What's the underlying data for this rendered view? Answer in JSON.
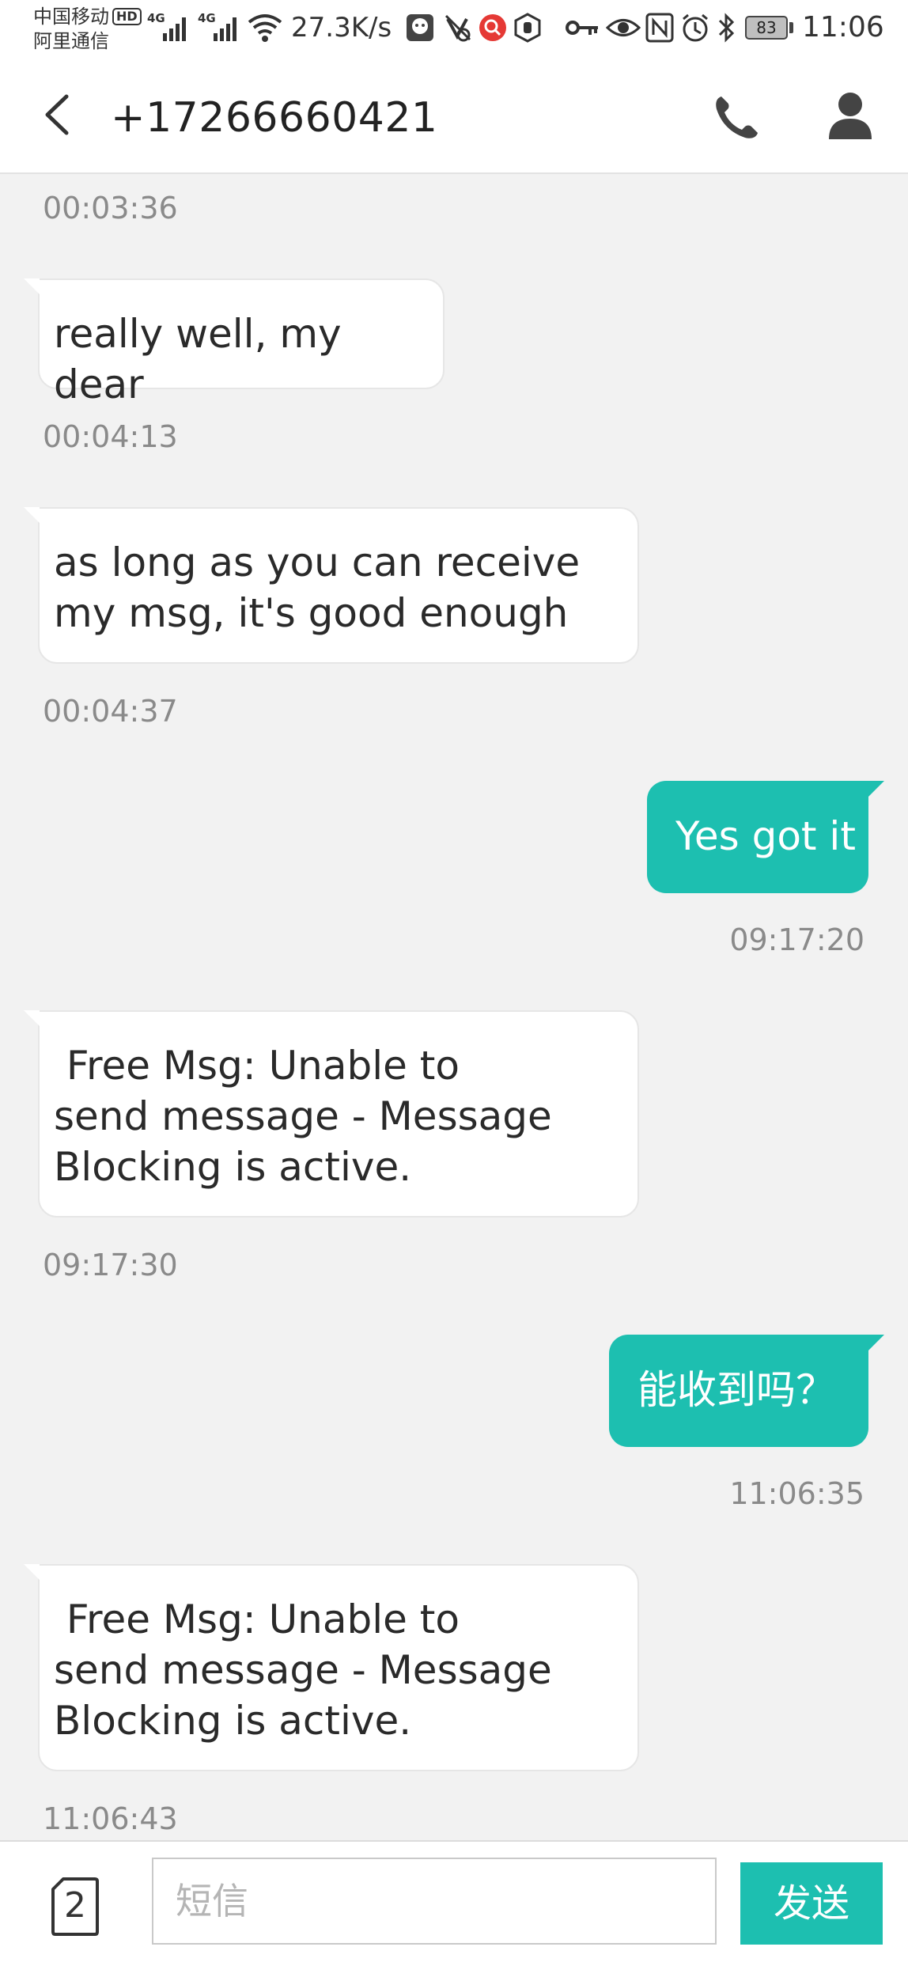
{
  "status_bar": {
    "carrier_primary": "中国移动",
    "carrier_secondary": "阿里通信",
    "hd_label": "HD",
    "network_1": "4G",
    "network_2": "4G",
    "net_speed": "27.3K/s",
    "battery_level": "83",
    "time": "11:06",
    "icons": [
      "wifi-icon",
      "chat-app-icon",
      "mute-icon",
      "search-app-icon",
      "shield-hand-icon",
      "key-icon",
      "eye-icon",
      "nfc-icon",
      "alarm-icon",
      "bluetooth-icon"
    ]
  },
  "header": {
    "title": "+17266660421",
    "back_icon": "chevron-left-icon",
    "call_icon": "phone-icon",
    "contact_icon": "person-icon"
  },
  "messages": [
    {
      "type": "timestamp",
      "side": "left",
      "text": "00:03:36"
    },
    {
      "type": "bubble",
      "side": "incoming",
      "text": "really well, my dear"
    },
    {
      "type": "timestamp",
      "side": "left",
      "text": "00:04:13"
    },
    {
      "type": "bubble",
      "side": "incoming",
      "text": "as long as you can receive\nmy msg, it's good enough"
    },
    {
      "type": "timestamp",
      "side": "left",
      "text": "00:04:37"
    },
    {
      "type": "bubble",
      "side": "outgoing",
      "text": "Yes got it"
    },
    {
      "type": "timestamp",
      "side": "right",
      "text": "09:17:20"
    },
    {
      "type": "bubble",
      "side": "incoming",
      "text": " Free Msg: Unable to\nsend message - Message\nBlocking is active."
    },
    {
      "type": "timestamp",
      "side": "left",
      "text": "09:17:30"
    },
    {
      "type": "bubble",
      "side": "outgoing",
      "text": "能收到吗？"
    },
    {
      "type": "timestamp",
      "side": "right",
      "text": "11:06:35"
    },
    {
      "type": "bubble",
      "side": "incoming",
      "text": " Free Msg: Unable to\nsend message - Message\nBlocking is active."
    },
    {
      "type": "timestamp",
      "side": "left",
      "text": "11:06:43"
    }
  ],
  "composer": {
    "sim_slot": "2",
    "placeholder": "短信",
    "value": "",
    "send_label": "发送"
  },
  "colors": {
    "accent": "#1dbfb0",
    "background": "#f2f2f2",
    "timestamp": "#8a8a8a"
  }
}
